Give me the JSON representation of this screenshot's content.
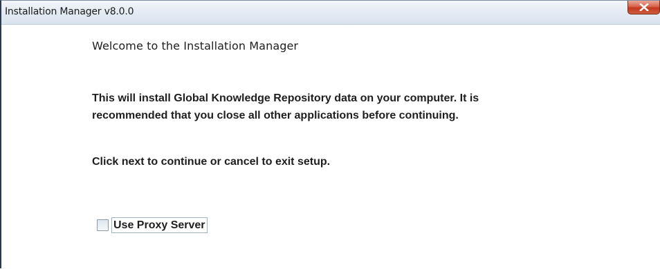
{
  "window": {
    "title": "Installation Manager v8.0.0"
  },
  "content": {
    "heading": "Welcome to the Installation Manager",
    "paragraph1_line1": "This will install Global Knowledge Repository data on your computer. It is",
    "paragraph1_line2": "recommended that you close all other applications before continuing.",
    "paragraph2": "Click next to continue or cancel to exit setup."
  },
  "proxy": {
    "label": "Use Proxy Server",
    "checked": false
  },
  "icons": {
    "close": "close-icon"
  }
}
